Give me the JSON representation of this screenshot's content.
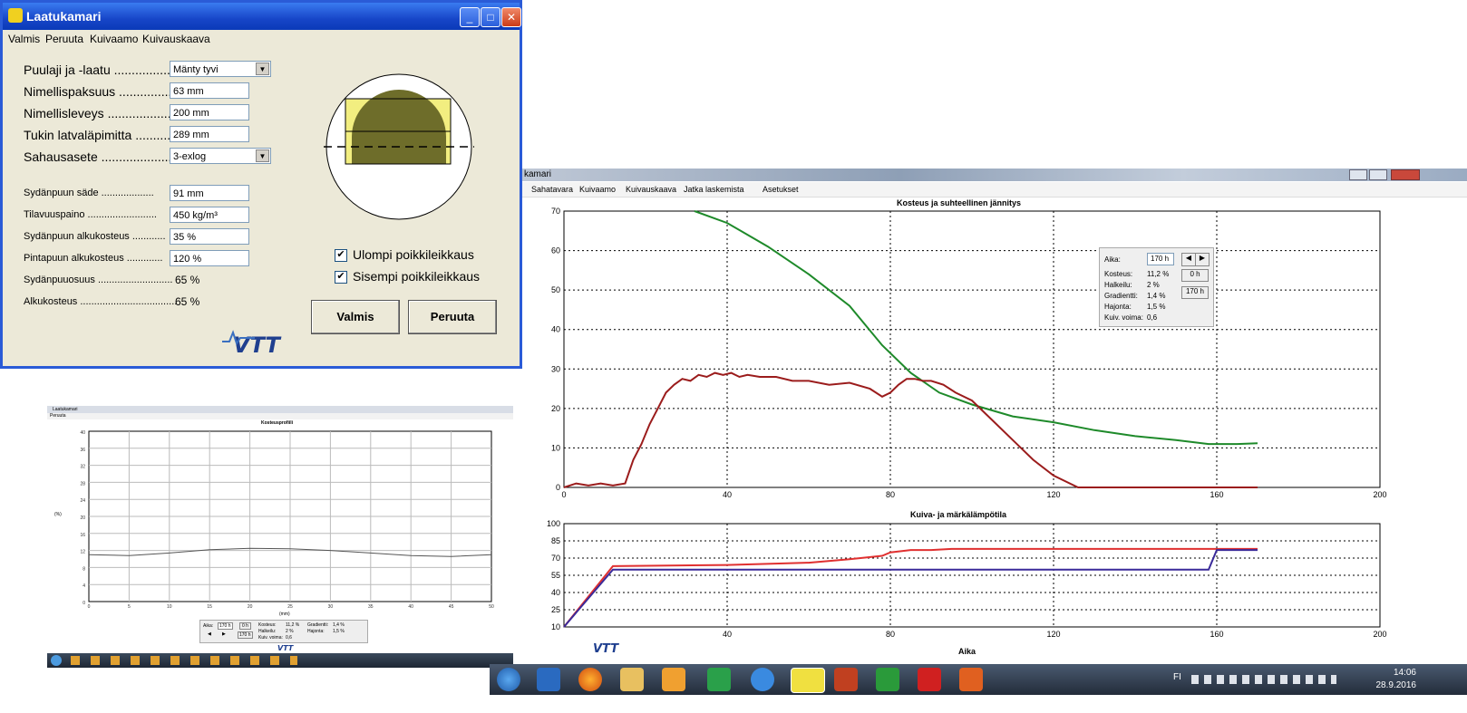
{
  "dialog": {
    "title": "Laatukamari",
    "menu": [
      "Valmis",
      "Peruuta",
      "Kuivaamo",
      "Kuivauskaava"
    ],
    "fields": {
      "puulaji_label": "Puulaji ja -laatu ...................",
      "puulaji_value": "Mänty tyvi",
      "paksuus_label": "Nimellispaksuus ..................",
      "paksuus_value": "63 mm",
      "leveys_label": "Nimellisleveys ...................",
      "leveys_value": "200 mm",
      "latva_label": "Tukin latvaläpimitta ..........",
      "latva_value": "289 mm",
      "sahaus_label": "Sahausasete ......................",
      "sahaus_value": "3-exlog",
      "sade_label": "Sydänpuun säde ...................",
      "sade_value": "91 mm",
      "tilavuus_label": "Tilavuuspaino .........................",
      "tilavuus_value": "450 kg/m³",
      "syd_alku_label": "Sydänpuun alkukosteus ............",
      "syd_alku_value": "35 %",
      "pinta_alku_label": "Pintapuun alkukosteus .............",
      "pinta_alku_value": "120 %",
      "osuus_label": "Sydänpuuosuus ...........................",
      "osuus_value": "65 %",
      "alku_label": "Alkukosteus ...................................",
      "alku_value": "65 %"
    },
    "check_outer": "Ulompi poikkileikkaus",
    "check_inner": "Sisempi poikkileikkaus",
    "btn_ok": "Valmis",
    "btn_cancel": "Peruuta",
    "logo": "VTT"
  },
  "main": {
    "title": "kamari",
    "menu": [
      "Sahatavara",
      "Kuivaamo",
      "Kuivauskaava",
      "Jatka laskemista",
      "Asetukset"
    ],
    "info": {
      "aika_label": "Aika:",
      "aika_value": "170 h",
      "kosteus_label": "Kosteus:",
      "kosteus_value": "11,2 %",
      "halkeilu_label": "Halkeilu:",
      "halkeilu_value": "2 %",
      "gradientti_label": "Gradientti:",
      "gradientti_value": "1,4 %",
      "hajonta_label": "Hajonta:",
      "hajonta_value": "1,5 %",
      "voima_label": "Kuiv. voima:",
      "voima_value": "0,6",
      "btn_0h": "0 h",
      "btn_170h": "170 h"
    },
    "xlabel": "Aika",
    "logo": "VTT"
  },
  "small": {
    "title": "Laatukamari",
    "menu": "Peruuta",
    "chart_title": "Kosteusprofiili",
    "ylabel": "(%)",
    "xlabel": "(mm)",
    "info": {
      "aika_label": "Aika:",
      "aika_value": "170 h",
      "btn_0h": "0 h",
      "btn_170h": "170 h",
      "kosteus_label": "Kosteus:",
      "kosteus_value": "11,2 %",
      "halkeilu_label": "Halkeilu:",
      "halkeilu_value": "2 %",
      "voima_label": "Kuiv. voima:",
      "voima_value": "0,6",
      "gradientti_label": "Gradientti:",
      "gradientti_value": "1,4 %",
      "hajonta_label": "Hajonta:",
      "hajonta_value": "1,5 %"
    },
    "logo": "VTT"
  },
  "taskbar": {
    "lang": "FI",
    "time": "14:06",
    "date": "28.9.2016",
    "icons": [
      "windows-start",
      "wifi",
      "firefox",
      "file-explorer",
      "media-player",
      "chart-app",
      "internet-explorer",
      "laatukamari",
      "tool-app",
      "cube-app",
      "pdf-reader",
      "powerpoint"
    ]
  },
  "chart_data": [
    {
      "type": "line",
      "title": "Kosteus ja suhteellinen jännitys",
      "xlim": [
        0,
        200
      ],
      "ylim": [
        0,
        70
      ],
      "x_ticks": [
        0,
        40,
        80,
        120,
        160,
        200
      ],
      "y_ticks": [
        0,
        10,
        20,
        30,
        40,
        50,
        60,
        70
      ],
      "grid": true,
      "series": [
        {
          "color": "#1e8a2a",
          "x": [
            32,
            40,
            50,
            60,
            70,
            78,
            85,
            92,
            100,
            110,
            120,
            130,
            140,
            150,
            158,
            165,
            170
          ],
          "y": [
            71,
            67,
            61,
            54,
            46,
            36,
            29,
            24,
            21,
            18,
            16.5,
            14.5,
            13,
            12,
            11,
            11,
            11.2
          ]
        },
        {
          "color": "#9b1c1c",
          "x": [
            0,
            3,
            6,
            9,
            12,
            15,
            17,
            19,
            21,
            23,
            25,
            27,
            29,
            31,
            33,
            35,
            37,
            39,
            41,
            43,
            45,
            48,
            52,
            56,
            60,
            65,
            70,
            75,
            78,
            80,
            82,
            84,
            86,
            88,
            90,
            93,
            96,
            100,
            105,
            110,
            115,
            120,
            126,
            140,
            160,
            170
          ],
          "y": [
            0,
            1,
            0.5,
            1,
            0.5,
            1,
            7,
            11,
            16,
            20,
            24,
            26,
            27.5,
            27,
            28.5,
            28,
            29,
            28.5,
            29,
            28,
            28.5,
            28,
            28,
            27,
            27,
            26,
            26.5,
            25,
            23,
            24,
            26,
            27.5,
            27.5,
            27,
            27,
            26,
            24,
            22,
            17,
            12,
            7,
            3,
            0,
            0,
            0,
            0
          ]
        }
      ]
    },
    {
      "type": "line",
      "title": "Kuiva- ja märkälämpötila",
      "xlabel": "Aika",
      "xlim": [
        0,
        200
      ],
      "ylim": [
        10,
        100
      ],
      "x_ticks": [
        40,
        80,
        120,
        160,
        200
      ],
      "y_ticks": [
        10,
        25,
        40,
        55,
        70,
        85,
        100
      ],
      "grid": true,
      "series": [
        {
          "color": "#e03030",
          "x": [
            0,
            12,
            40,
            60,
            70,
            78,
            80,
            85,
            90,
            95,
            120,
            160,
            170
          ],
          "y": [
            10,
            63,
            64,
            66,
            69,
            72,
            75,
            77,
            77,
            78,
            78,
            78,
            78
          ]
        },
        {
          "color": "#3a2a9a",
          "x": [
            0,
            12,
            40,
            80,
            120,
            158,
            160,
            170
          ],
          "y": [
            7,
            60,
            60,
            60,
            60,
            60,
            77,
            77
          ]
        }
      ]
    },
    {
      "type": "line",
      "title": "Kosteusprofiili",
      "xlabel": "(mm)",
      "ylabel": "(%)",
      "xlim": [
        0,
        50
      ],
      "ylim": [
        0,
        40
      ],
      "x_ticks": [
        0,
        5,
        10,
        15,
        20,
        25,
        30,
        35,
        40,
        45,
        50
      ],
      "y_ticks": [
        0,
        4,
        8,
        12,
        16,
        20,
        24,
        28,
        32,
        36,
        40
      ],
      "grid": true,
      "series": [
        {
          "color": "#555555",
          "x": [
            0,
            5,
            10,
            15,
            20,
            25,
            30,
            35,
            40,
            45,
            50
          ],
          "y": [
            11,
            10.8,
            11.4,
            12.2,
            12.5,
            12.4,
            12,
            11.4,
            10.8,
            10.6,
            11
          ]
        }
      ]
    }
  ]
}
